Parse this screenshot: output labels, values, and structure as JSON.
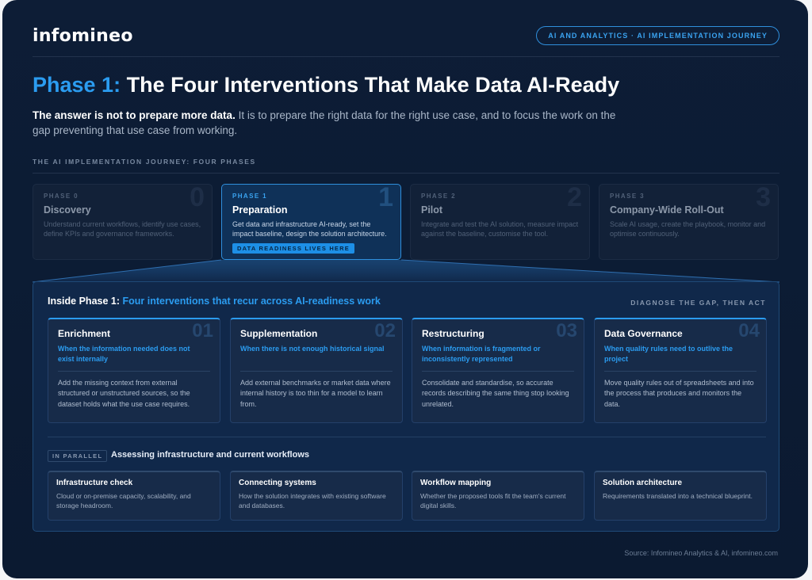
{
  "brand": {
    "logo": "infomineo"
  },
  "header": {
    "pill": "AI AND ANALYTICS · AI IMPLEMENTATION JOURNEY"
  },
  "title": {
    "accent": "Phase 1:",
    "text": "The Four Interventions That Make Data AI-Ready"
  },
  "lead": {
    "strong": "The answer is not to prepare more data.",
    "rest": "It is to prepare the right data for the right use case, and to focus the work on the gap preventing that use case from working."
  },
  "journey": {
    "label": "THE AI IMPLEMENTATION JOURNEY: FOUR PHASES",
    "phases": [
      {
        "tag": "PHASE 0",
        "num": "0",
        "name": "Discovery",
        "desc": "Understand current workflows, identify use cases, define KPIs and governance frameworks."
      },
      {
        "tag": "PHASE 1",
        "num": "1",
        "name": "Preparation",
        "desc": "Get data and infrastructure AI-ready, set the impact baseline, design the solution architecture.",
        "badge": "DATA READINESS LIVES HERE"
      },
      {
        "tag": "PHASE 2",
        "num": "2",
        "name": "Pilot",
        "desc": "Integrate and test the AI solution, measure impact against the baseline, customise the tool."
      },
      {
        "tag": "PHASE 3",
        "num": "3",
        "name": "Company-Wide Roll-Out",
        "desc": "Scale AI usage, create the playbook, monitor and optimise continuously."
      }
    ]
  },
  "inside": {
    "title_prefix": "Inside Phase 1:",
    "title_accent": "Four interventions that recur across AI-readiness work",
    "right_label": "DIAGNOSE THE GAP, THEN ACT",
    "interventions": [
      {
        "num": "01",
        "name": "Enrichment",
        "when": "When the information needed does not exist internally",
        "body": "Add the missing context from external structured or unstructured sources, so the dataset holds what the use case requires."
      },
      {
        "num": "02",
        "name": "Supplementation",
        "when": "When there is not enough historical signal",
        "body": "Add external benchmarks or market data where internal history is too thin for a model to learn from."
      },
      {
        "num": "03",
        "name": "Restructuring",
        "when": "When information is fragmented or inconsistently represented",
        "body": "Consolidate and standardise, so accurate records describing the same thing stop looking unrelated."
      },
      {
        "num": "04",
        "name": "Data Governance",
        "when": "When quality rules need to outlive the project",
        "body": "Move quality rules out of spreadsheets and into the process that produces and monitors the data."
      }
    ],
    "parallel_tag": "IN PARALLEL",
    "parallel_title": "Assessing infrastructure and current workflows",
    "assessments": [
      {
        "name": "Infrastructure check",
        "body": "Cloud or on-premise capacity, scalability, and storage headroom."
      },
      {
        "name": "Connecting systems",
        "body": "How the solution integrates with existing software and databases."
      },
      {
        "name": "Workflow mapping",
        "body": "Whether the proposed tools fit the team's current digital skills."
      },
      {
        "name": "Solution architecture",
        "body": "Requirements translated into a technical blueprint."
      }
    ]
  },
  "footer": {
    "source": "Source: Infomineo Analytics & AI, infomineo.com"
  }
}
